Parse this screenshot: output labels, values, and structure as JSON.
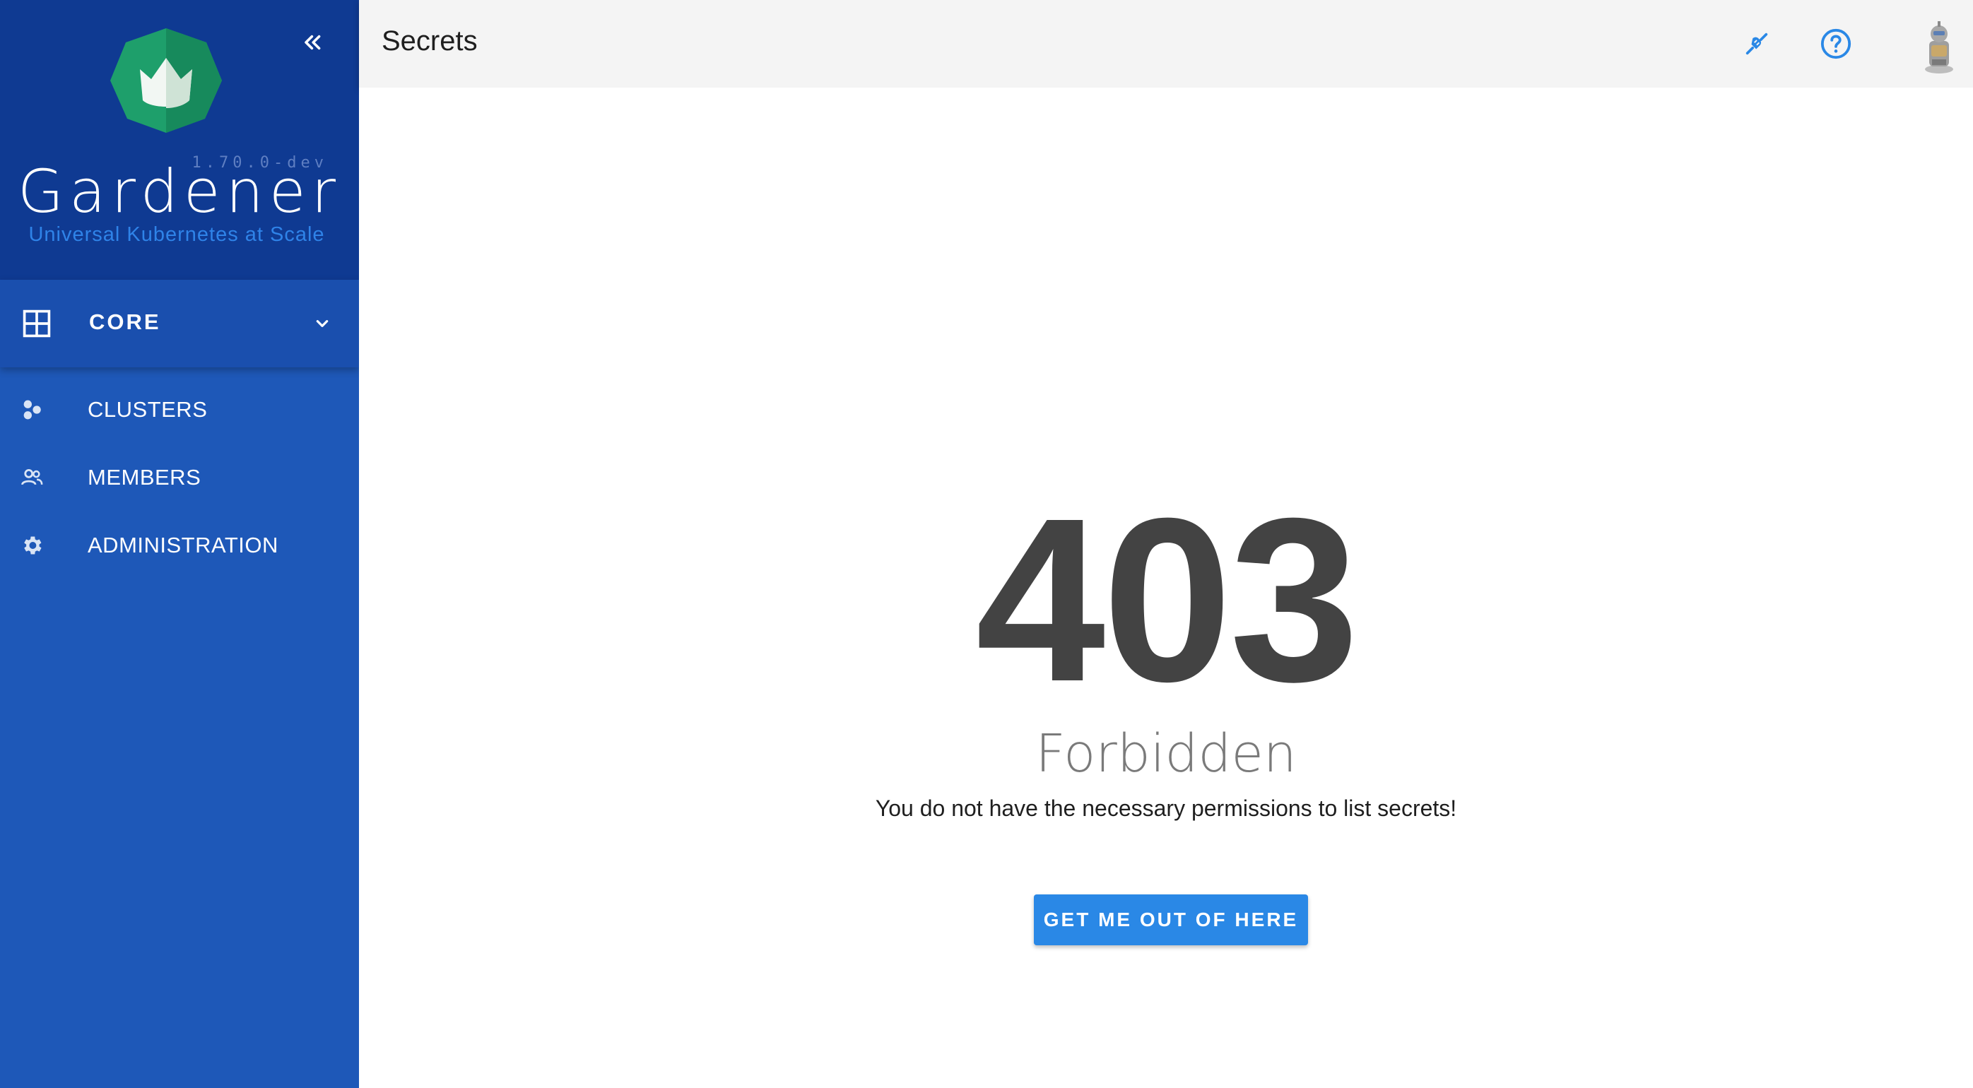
{
  "sidebar": {
    "version": "1.70.0-dev",
    "brand_title": "Gardener",
    "brand_subtitle": "Universal Kubernetes at Scale",
    "section": {
      "label": "CORE",
      "icon": "grid-icon"
    },
    "items": [
      {
        "label": "CLUSTERS",
        "icon": "clusters-icon"
      },
      {
        "label": "MEMBERS",
        "icon": "members-icon"
      },
      {
        "label": "ADMINISTRATION",
        "icon": "gear-icon"
      }
    ]
  },
  "topbar": {
    "title": "Secrets",
    "icons": [
      "plug-connected-icon",
      "help-icon",
      "user-avatar"
    ]
  },
  "error": {
    "code": "403",
    "title": "Forbidden",
    "message": "You do not have the necessary permissions to list secrets!",
    "button_label": "GET ME OUT OF HERE"
  },
  "colors": {
    "sidebar_bg": "#1e58b8",
    "sidebar_header_bg": "#0f3a92",
    "accent": "#2a88e6",
    "logo_green": "#1e9f6b"
  }
}
